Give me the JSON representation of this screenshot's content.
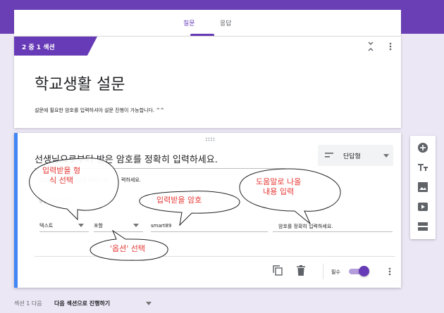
{
  "tabs": [
    {
      "label": "질문",
      "active": true
    },
    {
      "label": "응답",
      "active": false
    }
  ],
  "section": {
    "tag": "2 중 1 섹션",
    "title": "학교생활 설문",
    "description": "설문에 필요한 암호를 입력하셔야 설문 진행이 가능합니다. ^^"
  },
  "question": {
    "title": "선생님으로부터 받은 암호를 정확히 입력하세요.",
    "type_label": "단답형",
    "help_text": "설명 (선택사항) 암호를 정확히 입",
    "help_text_visible": "력하세요.",
    "validation_hint": "맞춤 오류 텍스트",
    "validation_type": "텍스트",
    "validation_condition": "포함",
    "validation_value": "smart89",
    "error_text": "암호를 정확히 입력하세요."
  },
  "footer": {
    "required_label": "필수",
    "required_on": true
  },
  "navigation": {
    "after_label": "섹션 1 다음",
    "after_value": "다음 섹션으로 진행하기"
  },
  "callouts": {
    "type_select": "입력받을 형\n식 선택",
    "help_text": "도움말로 나올\n내용 입력",
    "password": "입력받을 암호",
    "option": "'옵션' 선택"
  },
  "icons": {
    "collapse": "collapse-icon",
    "more": "more-vert-icon",
    "short_answer": "short-text-icon",
    "duplicate": "copy-icon",
    "delete": "trash-icon",
    "add_question": "add-circle-icon",
    "add_title": "title-text-icon",
    "add_image": "image-icon",
    "add_video": "video-icon",
    "add_section": "section-icon"
  },
  "colors": {
    "accent": "#673ab7",
    "header_band": "#6a3fb5",
    "active_border": "#4285f4",
    "callout": "#e53935"
  }
}
